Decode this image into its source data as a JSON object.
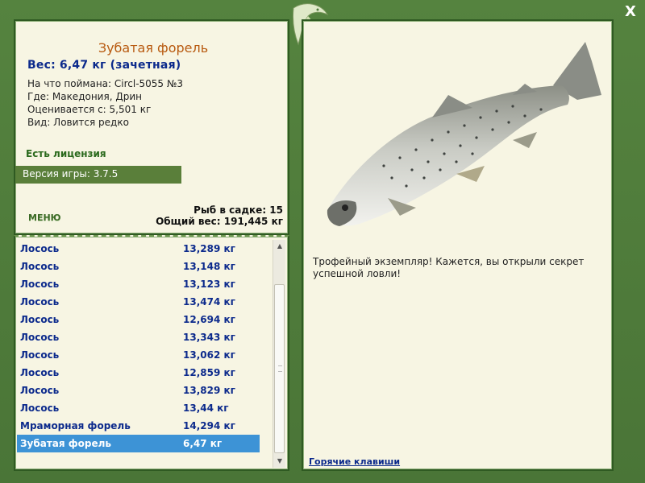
{
  "window": {
    "close_glyph": "X",
    "logo_icon": "fish-emblem-icon"
  },
  "fish_details": {
    "title": "Зубатая форель",
    "weight": "Вес: 6,47 кг (зачетная)",
    "caught_with": "На что поймана: Circl-5055 №3",
    "location": "Где: Македония, Дрин",
    "valued_from": "Оценивается с: 5,501 кг",
    "rarity": "Вид: Ловится редко"
  },
  "license": "Есть лицензия",
  "version": "Версия игры: 3.7.5",
  "menu_label": "МЕНЮ",
  "keepnet": {
    "count": "Рыб в садке: 15",
    "total_weight": "Общий вес: 191,445 кг"
  },
  "catch_list": [
    {
      "name": "Лосось",
      "weight": "13,289 кг"
    },
    {
      "name": "Лосось",
      "weight": "13,148 кг"
    },
    {
      "name": "Лосось",
      "weight": "13,123 кг"
    },
    {
      "name": "Лосось",
      "weight": "13,474 кг"
    },
    {
      "name": "Лосось",
      "weight": "12,694 кг"
    },
    {
      "name": "Лосось",
      "weight": "13,343 кг"
    },
    {
      "name": "Лосось",
      "weight": "13,062 кг"
    },
    {
      "name": "Лосось",
      "weight": "12,859 кг"
    },
    {
      "name": "Лосось",
      "weight": "13,829 кг"
    },
    {
      "name": "Лосось",
      "weight": "13,44 кг"
    },
    {
      "name": "Мраморная форель",
      "weight": "14,294 кг"
    },
    {
      "name": "Зубатая форель",
      "weight": "6,47 кг"
    }
  ],
  "selected_index": 11,
  "trophy_message": "Трофейный экземпляр! Кажется, вы открыли секрет успешной ловли!",
  "hotkeys_link": "Горячие клавиши",
  "colors": {
    "frame_green": "#4e7a3b",
    "panel_bg": "#f7f5e3",
    "title_orange": "#b85a10",
    "text_blue": "#0c2a8c",
    "selection_blue": "#3d93d6"
  }
}
